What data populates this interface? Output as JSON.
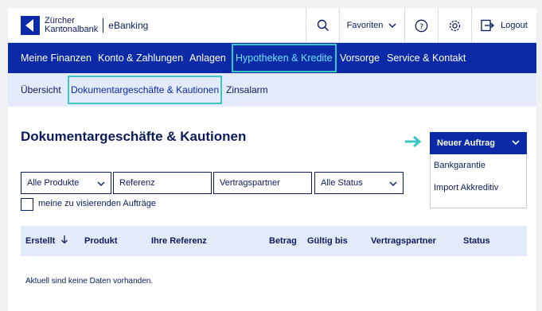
{
  "header": {
    "brand_line1": "Zürcher",
    "brand_line2": "Kantonalbank",
    "product": "eBanking",
    "favorites_label": "Favoriten",
    "logout_label": "Logout"
  },
  "mainnav": {
    "items": [
      {
        "label": "Meine Finanzen"
      },
      {
        "label": "Konto & Zahlungen"
      },
      {
        "label": "Anlagen"
      },
      {
        "label": "Hypotheken & Kredite",
        "active": true
      },
      {
        "label": "Vorsorge"
      },
      {
        "label": "Service & Kontakt"
      }
    ]
  },
  "subnav": {
    "items": [
      {
        "label": "Übersicht"
      },
      {
        "label": "Dokumentargeschäfte & Kautionen",
        "active": true
      },
      {
        "label": "Zinsalarm"
      }
    ]
  },
  "page": {
    "title": "Dokumentargeschäfte & Kautionen"
  },
  "new_order": {
    "label": "Neuer Auftrag",
    "options": [
      "Bankgarantie",
      "Import Akkreditiv"
    ]
  },
  "filters": {
    "products": "Alle Produkte",
    "reference_placeholder": "Referenz",
    "partner_placeholder": "Vertragspartner",
    "status": "Alle Status",
    "checkbox_label": "meine zu visierenden Aufträge"
  },
  "table": {
    "columns": [
      "Erstellt",
      "Produkt",
      "Ihre Referenz",
      "Betrag",
      "Gültig bis",
      "Vertragspartner",
      "Status"
    ],
    "sort_icon": "arrow-down-icon",
    "empty_message": "Aktuell sind keine Daten vorhanden."
  },
  "colors": {
    "primary": "#0b2aa8",
    "highlight": "#3dc5c5",
    "subnav_bg": "#e3eaf9",
    "text": "#0b1b5c"
  }
}
